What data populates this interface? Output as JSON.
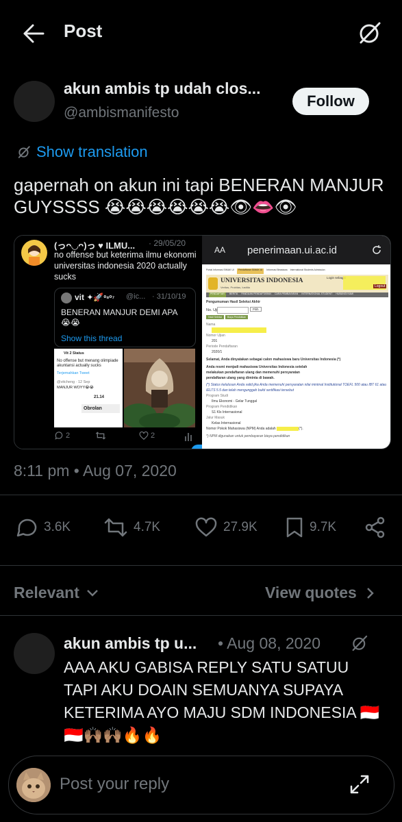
{
  "header": {
    "title": "Post"
  },
  "author": {
    "name": "akun ambis tp udah clos...",
    "handle": "@ambismanifesto",
    "follow_label": "Follow"
  },
  "translation": {
    "label": "Show translation"
  },
  "post": {
    "text": "gapernah on akun ini tapi BENERAN MANJUR GUYSSSS 😭😭😭😭😭😭👁👄👁",
    "timestamp": "8:11 pm • Aug 07, 2020"
  },
  "media_left": {
    "name": "(っᴖ◡ᴖ)っ ♥ ILMU...",
    "date": "· 29/05/20",
    "text": "no offense but keterima ilmu ekonomi universitas indonesia 2020 actually sucks",
    "quote": {
      "name": "vit ✦🚀",
      "suffix": "⁰⁸⁰⁷",
      "handle": "@ic...",
      "date": "· 31/10/19",
      "text": "BENERAN MANJUR DEMI APA 😭😭",
      "thread_link": "Show this thread"
    },
    "mini_tweet": {
      "name": "Vit 2 Status",
      "text": "No offense but menang olimpiade akuntansi actually sucks",
      "link": "Terjemahkan Tweet",
      "reply_name": "@vitcheng · 12 Sep",
      "reply_text": "MANJUR WOYY😭😭",
      "number": "21.14",
      "obrolan": "Obrolan"
    },
    "actions": {
      "reply": "2",
      "like": "2"
    }
  },
  "media_right": {
    "url": "penerimaan.ui.ac.id",
    "aa": "AA",
    "university": "UNIVERSITAS INDONESIA",
    "subtitle": "Veritas, Probitas, Iustitia",
    "nav": [
      "PENDAFTAR",
      "BERITA",
      "PANDUAN PENDAFTARAN",
      "CARA PEMBAYARAN",
      "INTERNATIONAL STUDENT",
      "HUBUNGI KAMI"
    ],
    "top_tabs": [
      "Portal Informasi SIMAK UI",
      "Pendaftaran SIMAK UI",
      "Informasi Beasiswa",
      "International Students Admission"
    ],
    "login_label": "Login sebagai",
    "logout_label": "Logout",
    "section_title": "Pengumuman Hasil Seleksi Akhir",
    "no_ujian": "No. Ujian",
    "pilih": "Pilih",
    "tabs": [
      "Hasil Seleksi",
      "Biaya Pendidikan"
    ],
    "fields": [
      {
        "label": "Nama",
        "value": ""
      },
      {
        "label": "Nomor Ujian",
        "value": "201"
      },
      {
        "label": "Periode Pendaftaran",
        "value": "2020/1"
      }
    ],
    "congrats": "Selamat, Anda dinyatakan sebagai calon mahasiswa baru Universitas Indonesia (*)",
    "bold_lines": [
      "Anda resmi menjadi mahasiswa Universitas Indonesia setelah",
      "melakukan pendaftaran ulang dan memenuhi persyaratan",
      "pendaftaran ulang yang diminta di bawah."
    ],
    "italic_note": "(*) Status kelulusan Anda valid jika Anda memenuhi persyaratan nilai minimal Institutional TOEFL 500 atau IBT 61 atau IELTS 5.5 dan telah mengunggah bukti sertifikasi tersebut",
    "program_fields": [
      {
        "label": "Program Studi",
        "value": "Ilmu Ekonomi - Gelar Tunggal"
      },
      {
        "label": "Program Pendidikan",
        "value": "S1 Kls Internasional"
      },
      {
        "label": "Jalur Masuk",
        "value": "Kelas Internasional"
      }
    ],
    "npm_line": "Nomor Pokok Mahasiswa (NPM) Anda adalah",
    "npm_suffix": "(*).",
    "footnote": "*) NPM digunakan untuk pembayaran biaya pendidikan"
  },
  "stats": {
    "replies": "3.6K",
    "reposts": "4.7K",
    "likes": "27.9K",
    "bookmarks": "9.7K"
  },
  "sort": {
    "relevant": "Relevant",
    "view_quotes": "View quotes"
  },
  "reply": {
    "name": "akun ambis tp u...",
    "date": "• Aug 08, 2020",
    "text": "AAA AKU GABISA REPLY SATU SATUU TAPI AKU DOAIN SEMUANYA SUPAYA KETERIMA AYO MAJU SDM INDONESIA 🇮🇩🇮🇩🙌🏽🙌🏽🔥🔥"
  },
  "composer": {
    "placeholder": "Post your reply"
  },
  "colors": {
    "accent": "#1d9bf0",
    "background": "#000000",
    "muted": "#71767b",
    "text": "#e7e9ea"
  }
}
